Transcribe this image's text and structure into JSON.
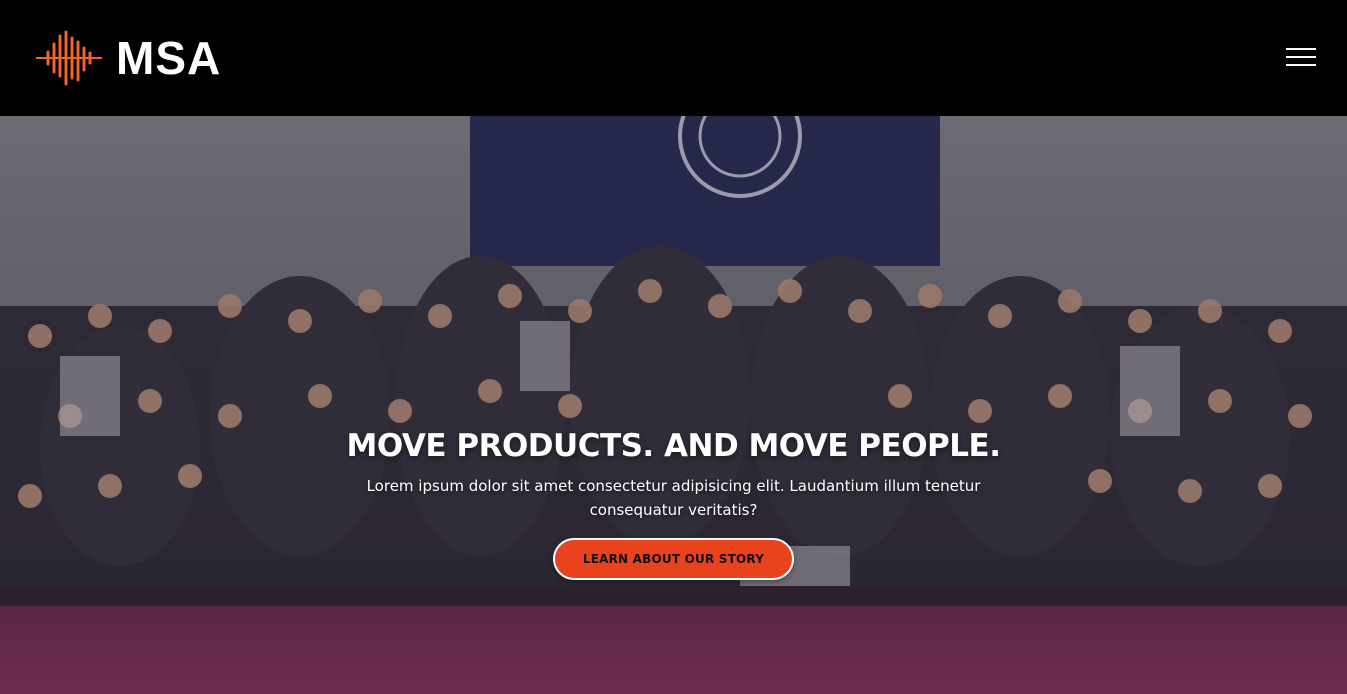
{
  "brand": {
    "name": "MSA",
    "logo_icon": "sound-wave-icon",
    "accent_color": "#f26522"
  },
  "nav": {
    "menu_icon": "hamburger-menu-icon"
  },
  "hero": {
    "title": "MOVE PRODUCTS. AND MOVE PEOPLE.",
    "subtitle": "Lorem ipsum dolor sit amet consectetur adipisicing elit. Laudantium illum tenetur consequatur veritatis?",
    "cta_label": "LEARN ABOUT OUR STORY",
    "cta_color": "#e8431d",
    "background": "group-photo"
  }
}
